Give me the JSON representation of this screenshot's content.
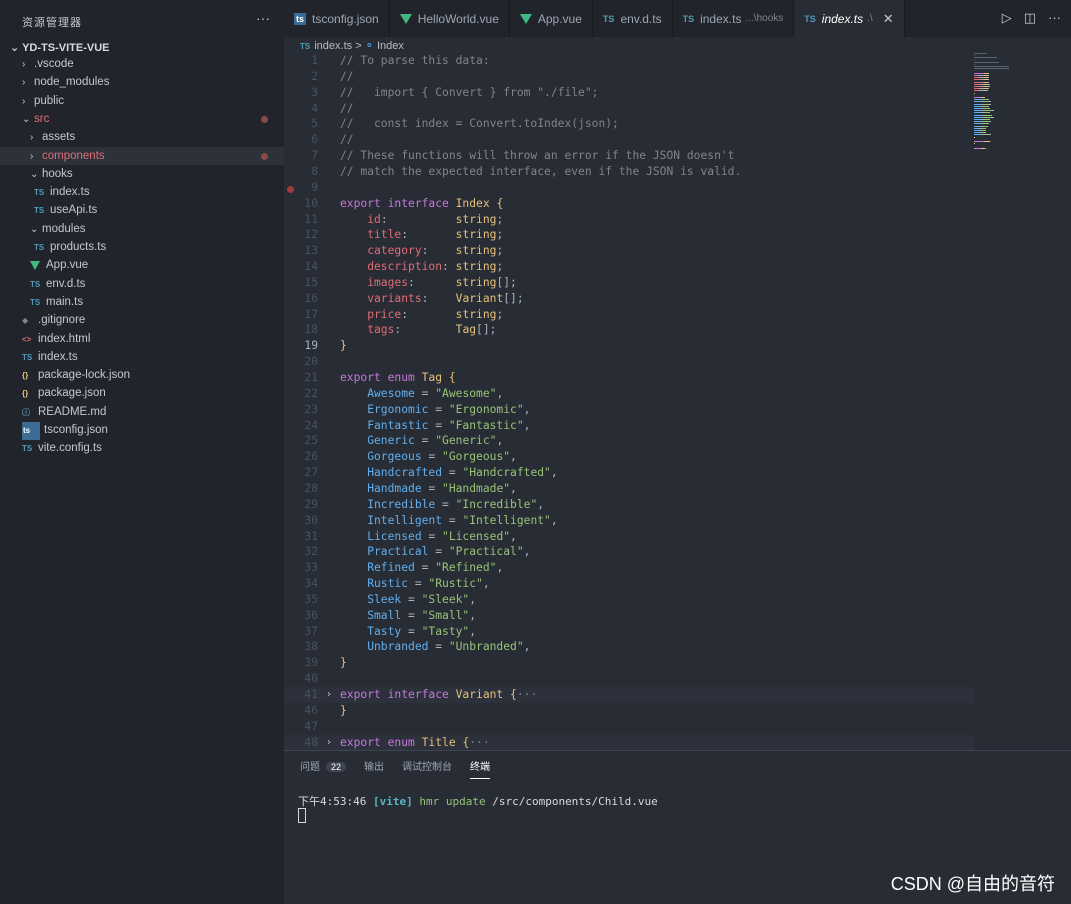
{
  "explorer": {
    "title": "资源管理器",
    "more": "···",
    "project": "YD-TS-VITE-VUE"
  },
  "tabs": [
    {
      "icon": "tsconfig",
      "label": "tsconfig.json",
      "desc": ""
    },
    {
      "icon": "vue",
      "label": "HelloWorld.vue",
      "desc": ""
    },
    {
      "icon": "vue",
      "label": "App.vue",
      "desc": ""
    },
    {
      "icon": "ts",
      "label": "env.d.ts",
      "desc": ""
    },
    {
      "icon": "ts",
      "label": "index.ts",
      "desc": "...\\hooks"
    },
    {
      "icon": "ts",
      "label": "index.ts",
      "desc": ".\\",
      "active": true
    }
  ],
  "tree": [
    {
      "label": ".vscode",
      "type": "folder",
      "open": false,
      "indent": 1
    },
    {
      "label": "node_modules",
      "type": "folder",
      "open": false,
      "indent": 1
    },
    {
      "label": "public",
      "type": "folder",
      "open": false,
      "indent": 1
    },
    {
      "label": "src",
      "type": "folder",
      "open": true,
      "indent": 1,
      "modified": true
    },
    {
      "label": "assets",
      "type": "folder",
      "open": false,
      "indent": 2
    },
    {
      "label": "components",
      "type": "folder",
      "open": false,
      "indent": 2,
      "modified": true,
      "selected": true
    },
    {
      "label": "hooks",
      "type": "folder",
      "open": true,
      "indent": 2
    },
    {
      "label": "index.ts",
      "type": "ts",
      "indent": 3
    },
    {
      "label": "useApi.ts",
      "type": "ts",
      "indent": 3
    },
    {
      "label": "modules",
      "type": "folder",
      "open": true,
      "indent": 2
    },
    {
      "label": "products.ts",
      "type": "ts",
      "indent": 3
    },
    {
      "label": "App.vue",
      "type": "vue",
      "indent": 2
    },
    {
      "label": "env.d.ts",
      "type": "ts",
      "indent": 2
    },
    {
      "label": "main.ts",
      "type": "ts",
      "indent": 2
    },
    {
      "label": ".gitignore",
      "type": "git",
      "indent": 1
    },
    {
      "label": "index.html",
      "type": "html",
      "indent": 1
    },
    {
      "label": "index.ts",
      "type": "ts",
      "indent": 1
    },
    {
      "label": "package-lock.json",
      "type": "json",
      "indent": 1
    },
    {
      "label": "package.json",
      "type": "json",
      "indent": 1
    },
    {
      "label": "README.md",
      "type": "md",
      "indent": 1
    },
    {
      "label": "tsconfig.json",
      "type": "tsconfig",
      "indent": 1
    },
    {
      "label": "vite.config.ts",
      "type": "ts",
      "indent": 1
    }
  ],
  "breadcrumb": {
    "file": "index.ts",
    "separator": ">",
    "symbol": "Index"
  },
  "code": [
    {
      "n": 1,
      "t": [
        [
          "// To parse this data:",
          "com"
        ]
      ]
    },
    {
      "n": 2,
      "t": [
        [
          "//",
          "com"
        ]
      ]
    },
    {
      "n": 3,
      "t": [
        [
          "//   import { Convert } from \"./file\";",
          "com"
        ]
      ]
    },
    {
      "n": 4,
      "t": [
        [
          "//",
          "com"
        ]
      ]
    },
    {
      "n": 5,
      "t": [
        [
          "//   const index = Convert.toIndex(json);",
          "com"
        ]
      ]
    },
    {
      "n": 6,
      "t": [
        [
          "//",
          "com"
        ]
      ]
    },
    {
      "n": 7,
      "t": [
        [
          "// These functions will throw an error if the JSON doesn't",
          "com"
        ]
      ]
    },
    {
      "n": 8,
      "t": [
        [
          "// match the expected interface, even if the JSON is valid.",
          "com"
        ]
      ]
    },
    {
      "n": 9,
      "t": []
    },
    {
      "n": 10,
      "t": [
        [
          "export ",
          "kw"
        ],
        [
          "interface ",
          "kw"
        ],
        [
          "Index ",
          "type"
        ],
        [
          "{",
          "brace"
        ]
      ]
    },
    {
      "n": 11,
      "t": [
        [
          "    id",
          "prop"
        ],
        [
          ":          ",
          "punc"
        ],
        [
          "string",
          "type"
        ],
        [
          ";",
          "punc"
        ]
      ]
    },
    {
      "n": 12,
      "t": [
        [
          "    title",
          "prop"
        ],
        [
          ":       ",
          "punc"
        ],
        [
          "string",
          "type"
        ],
        [
          ";",
          "punc"
        ]
      ]
    },
    {
      "n": 13,
      "t": [
        [
          "    category",
          "prop"
        ],
        [
          ":    ",
          "punc"
        ],
        [
          "string",
          "type"
        ],
        [
          ";",
          "punc"
        ]
      ]
    },
    {
      "n": 14,
      "t": [
        [
          "    description",
          "prop"
        ],
        [
          ": ",
          "punc"
        ],
        [
          "string",
          "type"
        ],
        [
          ";",
          "punc"
        ]
      ]
    },
    {
      "n": 15,
      "t": [
        [
          "    images",
          "prop"
        ],
        [
          ":      ",
          "punc"
        ],
        [
          "string",
          "type"
        ],
        [
          "[];",
          "punc"
        ]
      ]
    },
    {
      "n": 16,
      "t": [
        [
          "    variants",
          "prop"
        ],
        [
          ":    ",
          "punc"
        ],
        [
          "Variant",
          "type"
        ],
        [
          "[];",
          "punc"
        ]
      ]
    },
    {
      "n": 17,
      "t": [
        [
          "    price",
          "prop"
        ],
        [
          ":       ",
          "punc"
        ],
        [
          "string",
          "type"
        ],
        [
          ";",
          "punc"
        ]
      ]
    },
    {
      "n": 18,
      "t": [
        [
          "    tags",
          "prop"
        ],
        [
          ":        ",
          "punc"
        ],
        [
          "Tag",
          "type"
        ],
        [
          "[];",
          "punc"
        ]
      ]
    },
    {
      "n": 19,
      "t": [
        [
          "}",
          "brace"
        ]
      ],
      "current": true
    },
    {
      "n": 20,
      "t": []
    },
    {
      "n": 21,
      "t": [
        [
          "export ",
          "kw"
        ],
        [
          "enum ",
          "kw"
        ],
        [
          "Tag ",
          "type"
        ],
        [
          "{",
          "brace"
        ]
      ]
    },
    {
      "n": 22,
      "t": [
        [
          "    Awesome",
          "enum"
        ],
        [
          " = ",
          "punc"
        ],
        [
          "\"Awesome\"",
          "str"
        ],
        [
          ",",
          "punc"
        ]
      ]
    },
    {
      "n": 23,
      "t": [
        [
          "    Ergonomic",
          "enum"
        ],
        [
          " = ",
          "punc"
        ],
        [
          "\"Ergonomic\"",
          "str"
        ],
        [
          ",",
          "punc"
        ]
      ]
    },
    {
      "n": 24,
      "t": [
        [
          "    Fantastic",
          "enum"
        ],
        [
          " = ",
          "punc"
        ],
        [
          "\"Fantastic\"",
          "str"
        ],
        [
          ",",
          "punc"
        ]
      ]
    },
    {
      "n": 25,
      "t": [
        [
          "    Generic",
          "enum"
        ],
        [
          " = ",
          "punc"
        ],
        [
          "\"Generic\"",
          "str"
        ],
        [
          ",",
          "punc"
        ]
      ]
    },
    {
      "n": 26,
      "t": [
        [
          "    Gorgeous",
          "enum"
        ],
        [
          " = ",
          "punc"
        ],
        [
          "\"Gorgeous\"",
          "str"
        ],
        [
          ",",
          "punc"
        ]
      ]
    },
    {
      "n": 27,
      "t": [
        [
          "    Handcrafted",
          "enum"
        ],
        [
          " = ",
          "punc"
        ],
        [
          "\"Handcrafted\"",
          "str"
        ],
        [
          ",",
          "punc"
        ]
      ]
    },
    {
      "n": 28,
      "t": [
        [
          "    Handmade",
          "enum"
        ],
        [
          " = ",
          "punc"
        ],
        [
          "\"Handmade\"",
          "str"
        ],
        [
          ",",
          "punc"
        ]
      ]
    },
    {
      "n": 29,
      "t": [
        [
          "    Incredible",
          "enum"
        ],
        [
          " = ",
          "punc"
        ],
        [
          "\"Incredible\"",
          "str"
        ],
        [
          ",",
          "punc"
        ]
      ]
    },
    {
      "n": 30,
      "t": [
        [
          "    Intelligent",
          "enum"
        ],
        [
          " = ",
          "punc"
        ],
        [
          "\"Intelligent\"",
          "str"
        ],
        [
          ",",
          "punc"
        ]
      ]
    },
    {
      "n": 31,
      "t": [
        [
          "    Licensed",
          "enum"
        ],
        [
          " = ",
          "punc"
        ],
        [
          "\"Licensed\"",
          "str"
        ],
        [
          ",",
          "punc"
        ]
      ]
    },
    {
      "n": 32,
      "t": [
        [
          "    Practical",
          "enum"
        ],
        [
          " = ",
          "punc"
        ],
        [
          "\"Practical\"",
          "str"
        ],
        [
          ",",
          "punc"
        ]
      ]
    },
    {
      "n": 33,
      "t": [
        [
          "    Refined",
          "enum"
        ],
        [
          " = ",
          "punc"
        ],
        [
          "\"Refined\"",
          "str"
        ],
        [
          ",",
          "punc"
        ]
      ]
    },
    {
      "n": 34,
      "t": [
        [
          "    Rustic",
          "enum"
        ],
        [
          " = ",
          "punc"
        ],
        [
          "\"Rustic\"",
          "str"
        ],
        [
          ",",
          "punc"
        ]
      ]
    },
    {
      "n": 35,
      "t": [
        [
          "    Sleek",
          "enum"
        ],
        [
          " = ",
          "punc"
        ],
        [
          "\"Sleek\"",
          "str"
        ],
        [
          ",",
          "punc"
        ]
      ]
    },
    {
      "n": 36,
      "t": [
        [
          "    Small",
          "enum"
        ],
        [
          " = ",
          "punc"
        ],
        [
          "\"Small\"",
          "str"
        ],
        [
          ",",
          "punc"
        ]
      ]
    },
    {
      "n": 37,
      "t": [
        [
          "    Tasty",
          "enum"
        ],
        [
          " = ",
          "punc"
        ],
        [
          "\"Tasty\"",
          "str"
        ],
        [
          ",",
          "punc"
        ]
      ]
    },
    {
      "n": 38,
      "t": [
        [
          "    Unbranded",
          "enum"
        ],
        [
          " = ",
          "punc"
        ],
        [
          "\"Unbranded\"",
          "str"
        ],
        [
          ",",
          "punc"
        ]
      ]
    },
    {
      "n": 39,
      "t": [
        [
          "}",
          "brace"
        ]
      ]
    },
    {
      "n": 40,
      "t": []
    },
    {
      "n": 41,
      "t": [
        [
          "export ",
          "kw"
        ],
        [
          "interface ",
          "kw"
        ],
        [
          "Variant ",
          "type"
        ],
        [
          "{",
          "brace"
        ],
        [
          "···",
          "com"
        ]
      ],
      "folded": true,
      "hl": true
    },
    {
      "n": 46,
      "t": [
        [
          "}",
          "brace"
        ]
      ]
    },
    {
      "n": 47,
      "t": []
    },
    {
      "n": 48,
      "t": [
        [
          "export ",
          "kw"
        ],
        [
          "enum ",
          "kw"
        ],
        [
          "Title ",
          "type"
        ],
        [
          "{",
          "brace"
        ],
        [
          "···",
          "com"
        ]
      ],
      "folded": true,
      "hl": true
    }
  ],
  "panel": {
    "tabs": [
      {
        "label": "问题",
        "badge": "22"
      },
      {
        "label": "输出"
      },
      {
        "label": "调试控制台"
      },
      {
        "label": "终端",
        "active": true
      }
    ],
    "terminal": {
      "time": "下午4:53:46 ",
      "tag": "[vite]",
      "action": " hmr update",
      "path": " /src/components/Child.vue"
    }
  },
  "watermark": "CSDN @自由的音符",
  "colors": {
    "background": "#282c34",
    "sidebar": "#21252b",
    "keyword": "#c678dd",
    "type": "#e5c07b",
    "string": "#98c379",
    "property": "#e06c75",
    "comment": "#7f848e"
  }
}
